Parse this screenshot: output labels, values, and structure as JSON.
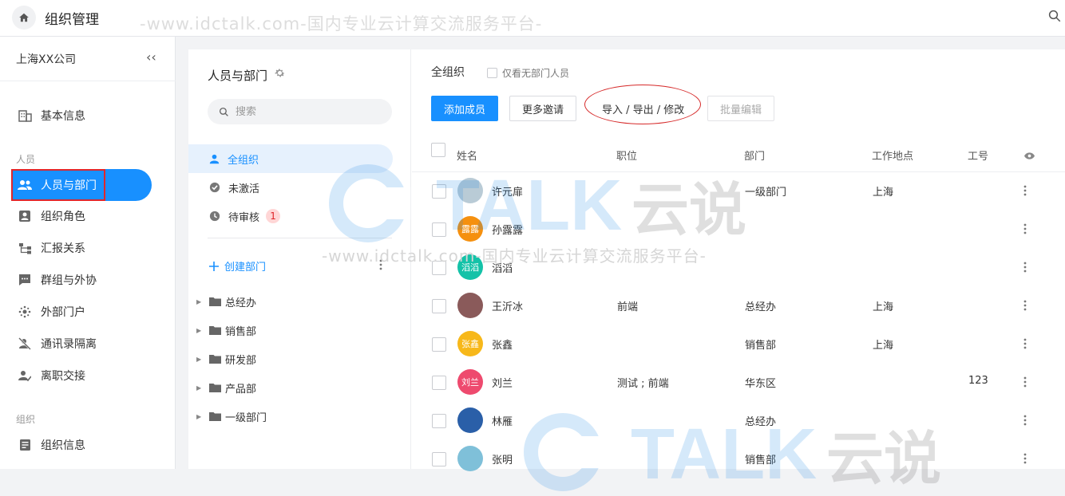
{
  "topbar": {
    "title": "组织管理",
    "watermark": "-www.idctalk.com-国内专业云计算交流服务平台-",
    "icons": {
      "home": "home-icon",
      "search": "search-icon"
    }
  },
  "sidebar": {
    "company": "上海XX公司",
    "collapse_glyph": "‹‹",
    "basic": "基本信息",
    "section_people": "人员",
    "section_org": "组织",
    "items": [
      {
        "label": "人员与部门",
        "icon": "people-icon",
        "active": true
      },
      {
        "label": "组织角色",
        "icon": "role-icon"
      },
      {
        "label": "汇报关系",
        "icon": "hierarchy-icon"
      },
      {
        "label": "群组与外协",
        "icon": "chat-group-icon"
      },
      {
        "label": "外部门户",
        "icon": "portal-icon"
      },
      {
        "label": "通讯录隔离",
        "icon": "isolation-icon"
      },
      {
        "label": "离职交接",
        "icon": "handover-icon"
      }
    ],
    "org_info": "组织信息"
  },
  "middle": {
    "title": "人员与部门",
    "search_placeholder": "搜索",
    "filters": [
      {
        "label": "全组织",
        "selected": true
      },
      {
        "label": "未激活"
      },
      {
        "label": "待审核",
        "badge": "1"
      }
    ],
    "create_dept": "创建部门",
    "departments": [
      "总经办",
      "销售部",
      "研发部",
      "产品部",
      "一级部门"
    ]
  },
  "main": {
    "org_label": "全组织",
    "only_no_dept": "仅看无部门人员",
    "buttons": {
      "add": "添加成员",
      "invite": "更多邀请",
      "import": "导入 / 导出 / 修改",
      "batch": "批量编辑"
    },
    "columns": [
      "姓名",
      "职位",
      "部门",
      "工作地点",
      "工号"
    ],
    "rows": [
      {
        "name": "许元扉",
        "position": "",
        "dept": "一级部门",
        "location": "上海",
        "id": "",
        "avatar_text": "",
        "avatar_color": "#b9cbd6"
      },
      {
        "name": "孙露露",
        "position": "",
        "dept": "",
        "location": "",
        "id": "",
        "avatar_text": "露露",
        "avatar_color": "#f5900f"
      },
      {
        "name": "滔滔",
        "position": "",
        "dept": "",
        "location": "",
        "id": "",
        "avatar_text": "滔滔",
        "avatar_color": "#14c2a8"
      },
      {
        "name": "王沂冰",
        "position": "前端",
        "dept": "总经办",
        "location": "上海",
        "id": "",
        "avatar_text": "",
        "avatar_color": "#8a5a5a"
      },
      {
        "name": "张鑫",
        "position": "",
        "dept": "销售部",
        "location": "上海",
        "id": "",
        "avatar_text": "张鑫",
        "avatar_color": "#f7b81a"
      },
      {
        "name": "刘兰",
        "position": "测试 ; 前端",
        "dept": "华东区",
        "location": "",
        "id": "123",
        "avatar_text": "刘兰",
        "avatar_color": "#ee4a6e"
      },
      {
        "name": "林雁",
        "position": "",
        "dept": "总经办",
        "location": "",
        "id": "",
        "avatar_text": "",
        "avatar_color": "#2a5fa8"
      },
      {
        "name": "张明",
        "position": "",
        "dept": "销售部",
        "location": "",
        "id": "",
        "avatar_text": "",
        "avatar_color": "#7fc0d9"
      }
    ]
  },
  "watermark_logo": {
    "text": "TALK",
    "cn": "云说"
  }
}
